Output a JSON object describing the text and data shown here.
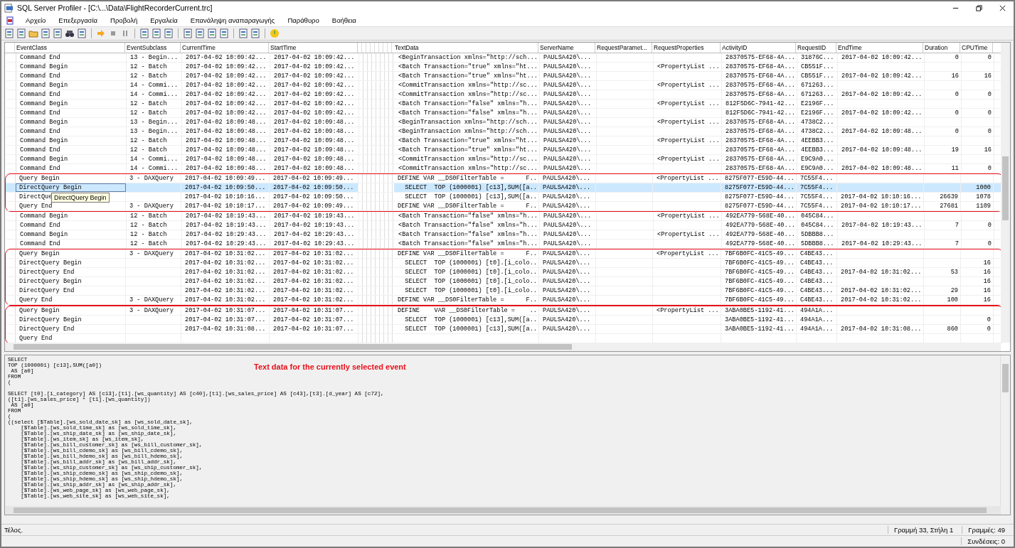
{
  "window": {
    "title": "SQL Server Profiler - [C:\\...\\Data\\FlightRecorderCurrent.trc]"
  },
  "menu": [
    "Αρχείο",
    "Επεξεργασία",
    "Προβολή",
    "Εργαλεία",
    "Επανάληψη αναπαραγωγής",
    "Παράθυρο",
    "Βοήθεια"
  ],
  "table": {
    "columns": [
      "EventClass",
      "EventSubclass",
      "CurrentTime",
      "StartTime",
      "TextData",
      "ServerName",
      "RequestParamet...",
      "RequestProperties",
      "ActivityID",
      "RequestID",
      "EndTime",
      "Duration",
      "CPUTime"
    ],
    "groups": [
      {
        "outlined": false,
        "rows": [
          {
            "selected": false,
            "cells": [
              "Command End",
              "13 - Begin...",
              "2017-04-02 10:09:42...",
              "2017-04-02 10:09:42...",
              "<BeginTransaction xmlns=\"http://sch...",
              "PAULSA420\\...",
              null,
              null,
              "28370575-EF68-4A...",
              "31876C...",
              "2017-04-02 10:09:42...",
              "0",
              "0"
            ]
          },
          {
            "selected": false,
            "cells": [
              "Command Begin",
              "12 - Batch",
              "2017-04-02 10:09:42...",
              "2017-04-02 10:09:42...",
              "<Batch Transaction=\"true\" xmlns=\"ht...",
              "PAULSA420\\...",
              null,
              "<PropertyList ...",
              "28370575-EF68-4A...",
              "CB551F...",
              null,
              null,
              null
            ]
          },
          {
            "selected": false,
            "cells": [
              "Command End",
              "12 - Batch",
              "2017-04-02 10:09:42...",
              "2017-04-02 10:09:42...",
              "<Batch Transaction=\"true\" xmlns=\"ht...",
              "PAULSA420\\...",
              null,
              null,
              "28370575-EF68-4A...",
              "CB551F...",
              "2017-04-02 10:09:42...",
              "16",
              "16"
            ]
          },
          {
            "selected": false,
            "cells": [
              "Command Begin",
              "14 - Commi...",
              "2017-04-02 10:09:42...",
              "2017-04-02 10:09:42...",
              "<CommitTransaction xmlns=\"http://sc...",
              "PAULSA420\\...",
              null,
              "<PropertyList ...",
              "28370575-EF68-4A...",
              "671263...",
              null,
              null,
              null
            ]
          },
          {
            "selected": false,
            "cells": [
              "Command End",
              "14 - Commi...",
              "2017-04-02 10:09:42...",
              "2017-04-02 10:09:42...",
              "<CommitTransaction xmlns=\"http://sc...",
              "PAULSA420\\...",
              null,
              null,
              "28370575-EF68-4A...",
              "671263...",
              "2017-04-02 10:09:42...",
              "0",
              "0"
            ]
          },
          {
            "selected": false,
            "cells": [
              "Command Begin",
              "12 - Batch",
              "2017-04-02 10:09:42...",
              "2017-04-02 10:09:42...",
              "<Batch Transaction=\"false\" xmlns=\"h...",
              "PAULSA420\\...",
              null,
              "<PropertyList ...",
              "812F5D6C-7941-42...",
              "E2196F...",
              null,
              null,
              null
            ]
          },
          {
            "selected": false,
            "cells": [
              "Command End",
              "12 - Batch",
              "2017-04-02 10:09:42...",
              "2017-04-02 10:09:42...",
              "<Batch Transaction=\"false\" xmlns=\"h...",
              "PAULSA420\\...",
              null,
              null,
              "812F5D6C-7941-42...",
              "E2196F...",
              "2017-04-02 10:09:42...",
              "0",
              "0"
            ]
          },
          {
            "selected": false,
            "cells": [
              "Command Begin",
              "13 - Begin...",
              "2017-04-02 10:09:48...",
              "2017-04-02 10:09:48...",
              "<BeginTransaction xmlns=\"http://sch...",
              "PAULSA420\\...",
              null,
              "<PropertyList ...",
              "28370575-EF68-4A...",
              "4738C2...",
              null,
              null,
              null
            ]
          },
          {
            "selected": false,
            "cells": [
              "Command End",
              "13 - Begin...",
              "2017-04-02 10:09:48...",
              "2017-04-02 10:09:48...",
              "<BeginTransaction xmlns=\"http://sch...",
              "PAULSA420\\...",
              null,
              null,
              "28370575-EF68-4A...",
              "4738C2...",
              "2017-04-02 10:09:48...",
              "0",
              "0"
            ]
          },
          {
            "selected": false,
            "cells": [
              "Command Begin",
              "12 - Batch",
              "2017-04-02 10:09:48...",
              "2017-04-02 10:09:48...",
              "<Batch Transaction=\"true\" xmlns=\"ht...",
              "PAULSA420\\...",
              null,
              "<PropertyList ...",
              "28370575-EF68-4A...",
              "4EEBB3...",
              null,
              null,
              null
            ]
          },
          {
            "selected": false,
            "cells": [
              "Command End",
              "12 - Batch",
              "2017-04-02 10:09:48...",
              "2017-04-02 10:09:48...",
              "<Batch Transaction=\"true\" xmlns=\"ht...",
              "PAULSA420\\...",
              null,
              null,
              "28370575-EF68-4A...",
              "4EEBB3...",
              "2017-04-02 10:09:48...",
              "19",
              "16"
            ]
          },
          {
            "selected": false,
            "cells": [
              "Command Begin",
              "14 - Commi...",
              "2017-04-02 10:09:48...",
              "2017-04-02 10:09:48...",
              "<CommitTransaction xmlns=\"http://sc...",
              "PAULSA420\\...",
              null,
              "<PropertyList ...",
              "28370575-EF68-4A...",
              "E9C9A0...",
              null,
              null,
              null
            ]
          },
          {
            "selected": false,
            "cells": [
              "Command End",
              "14 - Commi...",
              "2017-04-02 10:09:48...",
              "2017-04-02 10:09:48...",
              "<CommitTransaction xmlns=\"http://sc...",
              "PAULSA420\\...",
              null,
              null,
              "28370575-EF68-4A...",
              "E9C9A0...",
              "2017-04-02 10:09:48...",
              "11",
              "0"
            ]
          }
        ]
      },
      {
        "outlined": true,
        "rows": [
          {
            "selected": false,
            "cells": [
              "Query Begin",
              "3 - DAXQuery",
              "2017-04-02 10:09:49...",
              "2017-04-02 10:09:49...",
              "DEFINE VAR __DS0FilterTable =      F...",
              "PAULSA420\\...",
              null,
              "<PropertyList ...",
              "8275F077-E59D-44...",
              "7C55F4...",
              null,
              null,
              null
            ]
          },
          {
            "selected": true,
            "cells": [
              "DirectQuery Begin",
              null,
              "2017-04-02 10:09:50...",
              "2017-04-02 10:09:50...",
              "  SELECT  TOP (1000001) [c13],SUM([a...",
              "PAULSA420\\...",
              null,
              null,
              "8275F077-E59D-44...",
              "7C55F4...",
              null,
              null,
              "1000"
            ]
          },
          {
            "selected": false,
            "tooltip": "DirectQuery Begin",
            "cells": [
              "DirectQue",
              null,
              "2017-04-02 10:10:16...",
              "2017-04-02 10:09:50...",
              "  SELECT  TOP (1000001) [c13],SUM([a...",
              "PAULSA420\\...",
              null,
              null,
              "8275F077-E59D-44...",
              "7C55F4...",
              "2017-04-02 10:10:16...",
              "26639",
              "1078"
            ]
          },
          {
            "selected": false,
            "cells": [
              "Query End",
              "3 - DAXQuery",
              "2017-04-02 10:10:17...",
              "2017-04-02 10:09:49...",
              "DEFINE VAR __DS0FilterTable =      F...",
              "PAULSA420\\...",
              null,
              null,
              "8275F077-E59D-44...",
              "7C55F4...",
              "2017-04-02 10:10:17...",
              "27681",
              "1109"
            ]
          }
        ]
      },
      {
        "outlined": false,
        "rows": [
          {
            "selected": false,
            "cells": [
              "Command Begin",
              "12 - Batch",
              "2017-04-02 10:19:43...",
              "2017-04-02 10:19:43...",
              "<Batch Transaction=\"false\" xmlns=\"h...",
              "PAULSA420\\...",
              null,
              "<PropertyList ...",
              "492EA779-568E-40...",
              "045C84...",
              null,
              null,
              null
            ]
          },
          {
            "selected": false,
            "cells": [
              "Command End",
              "12 - Batch",
              "2017-04-02 10:19:43...",
              "2017-04-02 10:19:43...",
              "<Batch Transaction=\"false\" xmlns=\"h...",
              "PAULSA420\\...",
              null,
              null,
              "492EA779-568E-40...",
              "045C84...",
              "2017-04-02 10:19:43...",
              "7",
              "0"
            ]
          },
          {
            "selected": false,
            "cells": [
              "Command Begin",
              "12 - Batch",
              "2017-04-02 10:29:43...",
              "2017-04-02 10:29:43...",
              "<Batch Transaction=\"false\" xmlns=\"h...",
              "PAULSA420\\...",
              null,
              "<PropertyList ...",
              "492EA779-568E-40...",
              "5DBBB8...",
              null,
              null,
              null
            ]
          },
          {
            "selected": false,
            "cells": [
              "Command End",
              "12 - Batch",
              "2017-04-02 10:29:43...",
              "2017-04-02 10:29:43...",
              "<Batch Transaction=\"false\" xmlns=\"h...",
              "PAULSA420\\...",
              null,
              null,
              "492EA779-568E-40...",
              "5DBBB8...",
              "2017-04-02 10:29:43...",
              "7",
              "0"
            ]
          }
        ]
      },
      {
        "outlined": true,
        "rows": [
          {
            "selected": false,
            "cells": [
              "Query Begin",
              "3 - DAXQuery",
              "2017-04-02 10:31:02...",
              "2017-04-02 10:31:02...",
              "DEFINE VAR __DS0FilterTable =      F...",
              "PAULSA420\\...",
              null,
              "<PropertyList ...",
              "7BF6B0FC-41C5-49...",
              "C4BE43...",
              null,
              null,
              null
            ]
          },
          {
            "selected": false,
            "cells": [
              "DirectQuery Begin",
              null,
              "2017-04-02 10:31:02...",
              "2017-04-02 10:31:02...",
              "  SELECT  TOP (1000001) [t0].[i_colo...",
              "PAULSA420\\...",
              null,
              null,
              "7BF6B0FC-41C5-49...",
              "C4BE43...",
              null,
              null,
              "16"
            ]
          },
          {
            "selected": false,
            "cells": [
              "DirectQuery End",
              null,
              "2017-04-02 10:31:02...",
              "2017-04-02 10:31:02...",
              "  SELECT  TOP (1000001) [t0].[i_colo...",
              "PAULSA420\\...",
              null,
              null,
              "7BF6B0FC-41C5-49...",
              "C4BE43...",
              "2017-04-02 10:31:02...",
              "53",
              "16"
            ]
          },
          {
            "selected": false,
            "cells": [
              "DirectQuery Begin",
              null,
              "2017-04-02 10:31:02...",
              "2017-04-02 10:31:02...",
              "  SELECT  TOP (1000001) [t0].[i_colo...",
              "PAULSA420\\...",
              null,
              null,
              "7BF6B0FC-41C5-49...",
              "C4BE43...",
              null,
              null,
              "16"
            ]
          },
          {
            "selected": false,
            "cells": [
              "DirectQuery End",
              null,
              "2017-04-02 10:31:02...",
              "2017-04-02 10:31:02...",
              "  SELECT  TOP (1000001) [t0].[i_colo...",
              "PAULSA420\\...",
              null,
              null,
              "7BF6B0FC-41C5-49...",
              "C4BE43...",
              "2017-04-02 10:31:02...",
              "29",
              "16"
            ]
          },
          {
            "selected": false,
            "cells": [
              "Query End",
              "3 - DAXQuery",
              "2017-04-02 10:31:02...",
              "2017-04-02 10:31:02...",
              "DEFINE VAR __DS0FilterTable =      F...",
              "PAULSA420\\...",
              null,
              null,
              "7BF6B0FC-41C5-49...",
              "C4BE43...",
              "2017-04-02 10:31:02...",
              "100",
              "16"
            ]
          }
        ]
      },
      {
        "outlined": true,
        "rows": [
          {
            "selected": false,
            "cells": [
              "Query Begin",
              "3 - DAXQuery",
              "2017-04-02 10:31:07...",
              "2017-04-02 10:31:07...",
              "DEFINE    VAR __DS0FilterTable =    ...",
              "PAULSA420\\...",
              null,
              "<PropertyList ...",
              "3ABA0BE5-1192-41...",
              "494A1A...",
              null,
              null,
              null
            ]
          },
          {
            "selected": false,
            "cells": [
              "DirectQuery Begin",
              null,
              "2017-04-02 10:31:07...",
              "2017-04-02 10:31:07...",
              "  SELECT  TOP (1000001) [c13],SUM([a...",
              "PAULSA420\\...",
              null,
              null,
              "3ABA0BE5-1192-41...",
              "494A1A...",
              null,
              null,
              "0"
            ]
          },
          {
            "selected": false,
            "cells": [
              "DirectQuery End",
              null,
              "2017-04-02 10:31:08...",
              "2017-04-02 10:31:07...",
              "  SELECT  TOP (1000001) [c13],SUM([a...",
              "PAULSA420\\...",
              null,
              null,
              "3ABA0BE5-1192-41...",
              "494A1A...",
              "2017-04-02 10:31:08...",
              "860",
              "0"
            ]
          },
          {
            "selected": false,
            "cells": [
              "Query End",
              null,
              null,
              null,
              null,
              null,
              null,
              null,
              null,
              null,
              null,
              null,
              null
            ]
          }
        ]
      }
    ]
  },
  "text_pane": {
    "blocks": [
      [
        "SELECT",
        "TOP (1000001) [c13],SUM([a0])",
        " AS [a0]",
        "FROM",
        "("
      ],
      [
        "SELECT [t0].[i_category] AS [c13],[t1].[ws_quantity] AS [c40],[t1].[ws_sales_price] AS [c43],[t3].[d_year] AS [c72],",
        "([t1].[ws_sales_price] * [t1].[ws_quantity])",
        " AS [a0]",
        "FROM",
        "(",
        "((select [$Table].[ws_sold_date_sk] as [ws_sold_date_sk],",
        "    [$Table].[ws_sold_time_sk] as [ws_sold_time_sk],",
        "    [$Table].[ws_ship_date_sk] as [ws_ship_date_sk],",
        "    [$Table].[ws_item_sk] as [ws_item_sk],",
        "    [$Table].[ws_bill_customer_sk] as [ws_bill_customer_sk],",
        "    [$Table].[ws_bill_cdemo_sk] as [ws_bill_cdemo_sk],",
        "    [$Table].[ws_bill_hdemo_sk] as [ws_bill_hdemo_sk],",
        "    [$Table].[ws_bill_addr_sk] as [ws_bill_addr_sk],",
        "    [$Table].[ws_ship_customer_sk] as [ws_ship_customer_sk],",
        "    [$Table].[ws_ship_cdemo_sk] as [ws_ship_cdemo_sk],",
        "    [$Table].[ws_ship_hdemo_sk] as [ws_ship_hdemo_sk],",
        "    [$Table].[ws_ship_addr_sk] as [ws_ship_addr_sk],",
        "    [$Table].[ws_web_page_sk] as [ws_web_page_sk],",
        "    [$Table].[ws_web_site_sk] as [ws_web_site_sk],"
      ]
    ],
    "annotation": "Text data for the currently selected event"
  },
  "status_bar": {
    "message": "Τέλος.",
    "position": "Γραμμή 33, Στήλη 1",
    "lines": "Γραμμές: 49",
    "connections": "Συνδέσεις: 0"
  }
}
